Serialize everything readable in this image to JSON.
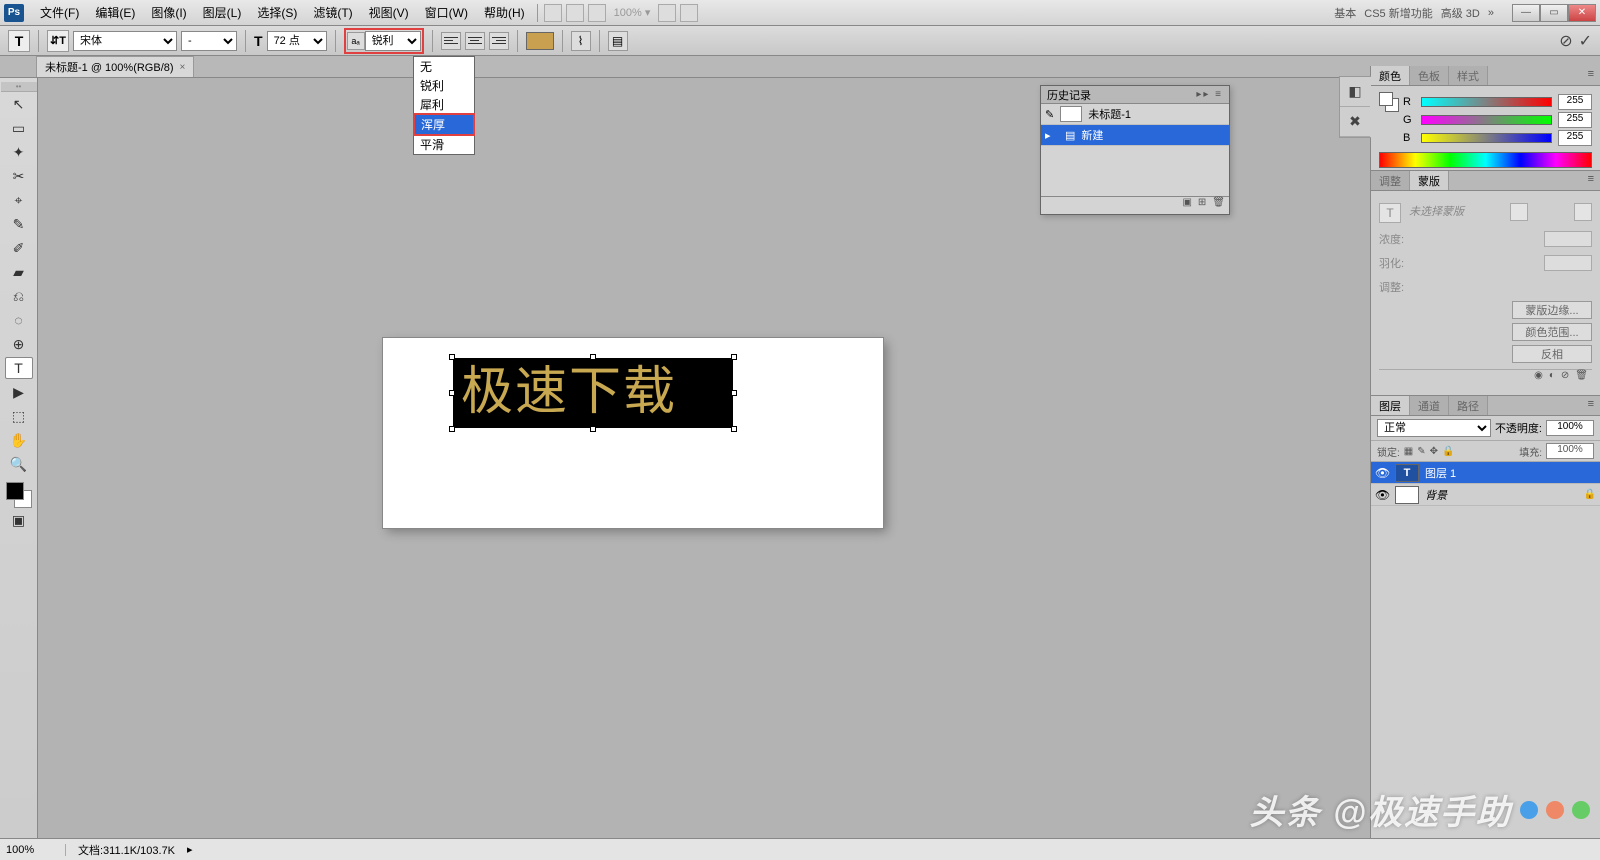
{
  "app_logo": "Ps",
  "menubar": [
    "文件(F)",
    "编辑(E)",
    "图像(I)",
    "图层(L)",
    "选择(S)",
    "滤镜(T)",
    "视图(V)",
    "窗口(W)",
    "帮助(H)"
  ],
  "menubar_zoom": "100% ▾",
  "menubar_right": [
    "基本",
    "CS5 新增功能",
    "高级 3D",
    "»"
  ],
  "options": {
    "font_family": "宋体",
    "font_style": "-",
    "font_size_label": "T",
    "font_size": "72 点",
    "aa_label": "aₐ",
    "aa_value": "锐利",
    "aa_options": [
      "无",
      "锐利",
      "犀利",
      "浑厚",
      "平滑"
    ],
    "aa_highlight": "浑厚",
    "cancel_icon": "⊘",
    "commit_icon": "✓"
  },
  "doc_tab": {
    "title": "未标题-1 @ 100%(RGB/8)",
    "close": "×"
  },
  "canvas_text": "极速下载",
  "toolbox_tools": [
    "↖",
    "▭",
    "✦",
    "✂",
    "⌖",
    "✎",
    "✐",
    "▰",
    "⎌",
    "◌",
    "⊕",
    "T",
    "▶",
    "⬚",
    "✋",
    "🔍"
  ],
  "toolbox_selected_index": 11,
  "history": {
    "title": "历史记录",
    "rows": [
      {
        "label": "未标题-1",
        "sel": false
      },
      {
        "label": "新建",
        "sel": true
      }
    ]
  },
  "color_panel": {
    "tabs": [
      "颜色",
      "色板",
      "样式"
    ],
    "channels": [
      {
        "label": "R",
        "value": "255",
        "cls": "slider-r"
      },
      {
        "label": "G",
        "value": "255",
        "cls": "slider-g"
      },
      {
        "label": "B",
        "value": "255",
        "cls": "slider-b"
      }
    ]
  },
  "adjustments": {
    "tabs": [
      "调整",
      "蒙版"
    ],
    "placeholder": "未选择蒙版",
    "density_label": "浓度:",
    "feather_label": "羽化:",
    "adjust_label": "调整:",
    "btn_edge": "蒙版边缘...",
    "btn_range": "颜色范围...",
    "btn_invert": "反相"
  },
  "layers": {
    "tabs": [
      "图层",
      "通道",
      "路径"
    ],
    "blend_mode": "正常",
    "opacity_label": "不透明度:",
    "opacity_value": "100%",
    "lock_label": "锁定:",
    "fill_label": "填充:",
    "fill_value": "100%",
    "rows": [
      {
        "name": "图层 1",
        "type": "T",
        "sel": true,
        "lock": ""
      },
      {
        "name": "背景",
        "type": "",
        "sel": false,
        "lock": "🔒"
      }
    ]
  },
  "status": {
    "zoom": "100%",
    "doc": "文档:311.1K/103.7K"
  },
  "watermark": "头条 @极速手助"
}
